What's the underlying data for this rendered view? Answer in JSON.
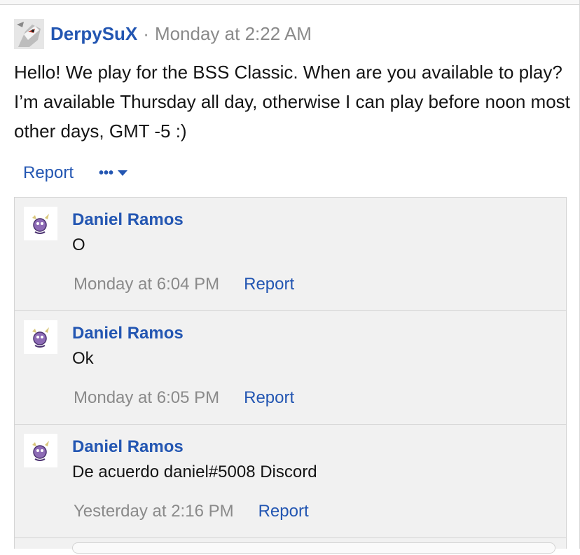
{
  "post": {
    "author": "DerpySuX",
    "separator": "·",
    "timestamp": "Monday at 2:22 AM",
    "body": "Hello! We play for the BSS Classic. When are you available to play? I’m available Thursday all day, otherwise I can play before noon most other days, GMT -5 :)",
    "actions": {
      "report": "Report",
      "more": "•••"
    }
  },
  "comments": [
    {
      "author": "Daniel Ramos",
      "text": "O",
      "time": "Monday at 6:04 PM",
      "report": "Report"
    },
    {
      "author": "Daniel Ramos",
      "text": "Ok",
      "time": "Monday at 6:05 PM",
      "report": "Report"
    },
    {
      "author": "Daniel Ramos",
      "text": "De acuerdo daniel#5008 Discord",
      "time": "Yesterday at 2:16 PM",
      "report": "Report"
    }
  ],
  "colors": {
    "link": "#2356b2",
    "muted": "#8a8a8a",
    "panel": "#f1f1f1"
  }
}
